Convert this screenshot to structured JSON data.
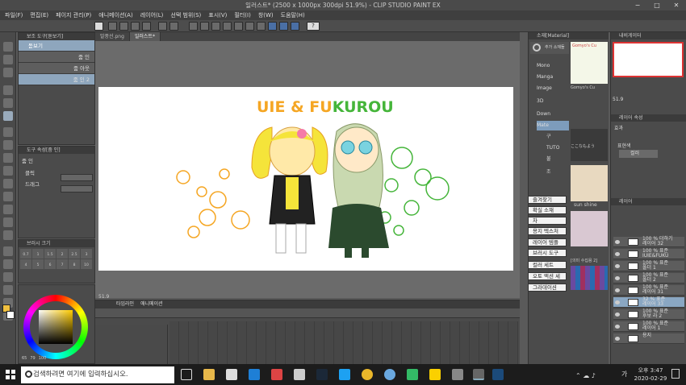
{
  "window": {
    "title": "일러스트* (2500 x 1000px 300dpi 51.9%) - CLIP STUDIO PAINT EX",
    "min": "−",
    "max": "□",
    "close": "✕"
  },
  "menu": [
    "파일(F)",
    "편집(E)",
    "페이지 관리(P)",
    "애니메이션(A)",
    "레이어(L)",
    "선택 범위(S)",
    "표시(V)",
    "필터(I)",
    "창(W)",
    "도움말(H)"
  ],
  "sub_tool": {
    "title": "보조 도구[돋보기]",
    "items": [
      "돋보기",
      "줌 인",
      "줌 아웃",
      "줌 인 2"
    ]
  },
  "tool_prop": {
    "title": "도구 속성[줌 인]",
    "tool_name": "줌 인",
    "rows": [
      "클릭",
      "드래그"
    ]
  },
  "brush_size": {
    "title": "브러시 크기",
    "sizes": [
      "0.7",
      "1",
      "1.5",
      "2",
      "2.5",
      "3",
      "4",
      "5",
      "6",
      "7",
      "8",
      "10",
      "12",
      "15",
      "17",
      "20",
      "25",
      "30"
    ]
  },
  "color_values": [
    "65",
    "79",
    "100"
  ],
  "doc_tabs": [
    "말풍선.png",
    "일러스트*"
  ],
  "artwork": {
    "logo_part1": "UIE & FU",
    "logo_part2": "KUROU",
    "accent_orange": "#f5a623",
    "accent_green": "#45b53a"
  },
  "canvas_status": {
    "zoom": "51.9"
  },
  "timeline": {
    "tab1": "타임라인",
    "tab2": "애니메이션"
  },
  "material": {
    "title": "소재[Material]",
    "search_label": "추가 소재들",
    "tree": [
      "Mono",
      "Manga",
      "Image",
      "3D",
      "Down",
      "Mate",
      "구",
      "TUTO",
      "불",
      "조"
    ],
    "thumb_labels": [
      "Gomyo's Cu",
      "Gomyo's Cu",
      "ここなもよう",
      "sun shine",
      "[의미 수집용 2]"
    ],
    "list_buttons": [
      "즐겨찾기",
      "확실 소재",
      "차",
      "용지 텍스처",
      "레이어 템플",
      "브러시 도구",
      "컬러 세트",
      "오토 액션 세",
      "그라데이션"
    ]
  },
  "navigator": {
    "title": "내비게이터",
    "zoom": "51.9"
  },
  "layer_prop": {
    "title": "레이어 속성",
    "effect_label": "효과",
    "color_label": "표현색",
    "color_value": "컬러"
  },
  "layers": {
    "title": "레이어",
    "items": [
      {
        "line1": "100 % 더하기",
        "line2": "레이어 32"
      },
      {
        "line1": "100 % 표준",
        "line2": "IUIE&FUKU"
      },
      {
        "line1": "100 % 표준",
        "line2": "폴더 1"
      },
      {
        "line1": "100 % 표준",
        "line2": "폴더 2"
      },
      {
        "line1": "100 % 표준",
        "line2": "레이어 31"
      },
      {
        "line1": "32 % 표준",
        "line2": "레이어 33"
      },
      {
        "line1": "100 % 표준",
        "line2": "후보 라 2"
      },
      {
        "line1": "100 % 표준",
        "line2": "레이어 1"
      },
      {
        "line1": "",
        "line2": "용지"
      }
    ]
  },
  "taskbar": {
    "search_placeholder": "검색하려면 여기에 입력하십시오.",
    "time": "오후 3:47",
    "date": "2020-02-29",
    "ime": "가"
  }
}
